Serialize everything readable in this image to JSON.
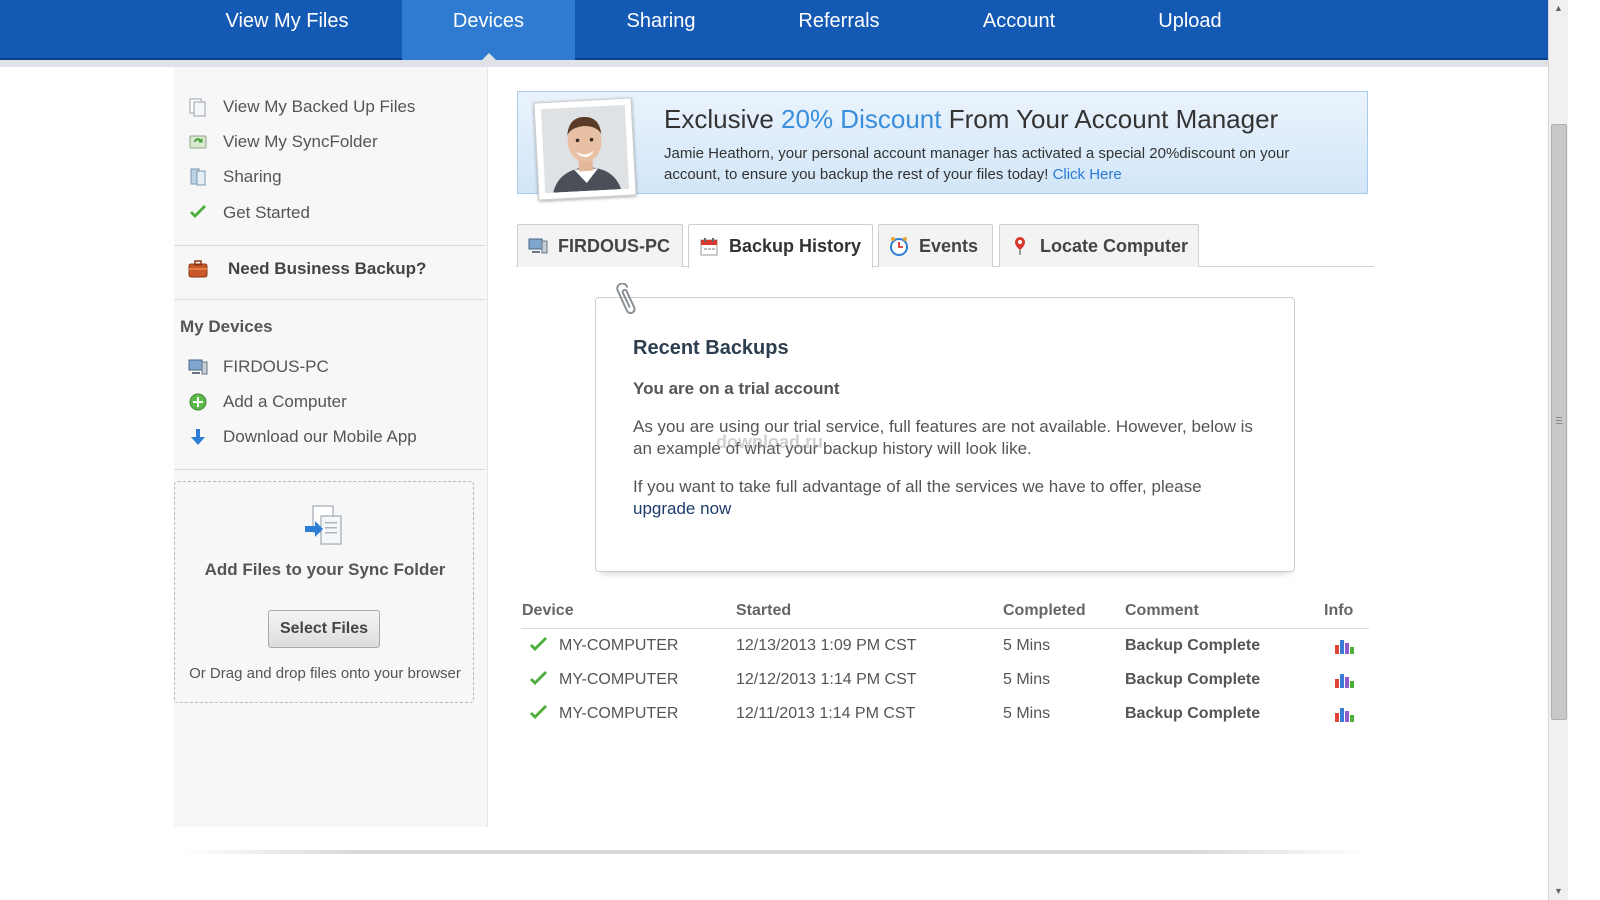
{
  "nav": {
    "items": [
      {
        "label": "View My Files"
      },
      {
        "label": "Devices"
      },
      {
        "label": "Sharing"
      },
      {
        "label": "Referrals"
      },
      {
        "label": "Account"
      },
      {
        "label": "Upload"
      }
    ],
    "active": "Devices"
  },
  "sidebar": {
    "links": [
      {
        "label": "View My Backed Up Files",
        "icon": "files-icon"
      },
      {
        "label": "View My SyncFolder",
        "icon": "sync-icon"
      },
      {
        "label": "Sharing",
        "icon": "share-icon"
      },
      {
        "label": "Get Started",
        "icon": "checkmark-icon"
      }
    ],
    "business": "Need Business Backup?",
    "my_devices_heading": "My Devices",
    "devices": [
      {
        "label": "FIRDOUS-PC",
        "icon": "computer-icon"
      },
      {
        "label": "Add a Computer",
        "icon": "plus-circle-icon"
      },
      {
        "label": "Download our Mobile App",
        "icon": "download-arrow-icon"
      }
    ],
    "dropzone": {
      "title": "Add Files to your Sync Folder",
      "button": "Select Files",
      "hint": "Or Drag and drop files onto your browser"
    }
  },
  "banner": {
    "title_pre": "Exclusive ",
    "title_highlight": "20% Discount",
    "title_post": " From Your Account Manager",
    "text": "Jamie Heathorn, your personal account manager has activated a special 20%discount on your account, to ensure you backup the rest of your files today!",
    "link": "Click Here"
  },
  "tabs": [
    {
      "label": "FIRDOUS-PC",
      "icon": "computer-icon"
    },
    {
      "label": "Backup History",
      "icon": "calendar-icon"
    },
    {
      "label": "Events",
      "icon": "clock-icon"
    },
    {
      "label": "Locate Computer",
      "icon": "map-pin-icon"
    }
  ],
  "active_tab": "Backup History",
  "recent": {
    "heading": "Recent Backups",
    "subheading": "You are on a trial account",
    "para1": "As you are using our trial service, full features are not available. However, below is an example of what your backup history will look like.",
    "para2": "If you want to take full advantage of all the services we have to offer, please",
    "link": "upgrade now"
  },
  "watermark": "download.ru",
  "table": {
    "headers": [
      "Device",
      "Started",
      "Completed",
      "Comment",
      "Info"
    ],
    "rows": [
      {
        "device": "MY-COMPUTER",
        "started": "12/13/2013 1:09 PM CST",
        "completed": "5 Mins",
        "comment": "Backup Complete"
      },
      {
        "device": "MY-COMPUTER",
        "started": "12/12/2013 1:14 PM CST",
        "completed": "5 Mins",
        "comment": "Backup Complete"
      },
      {
        "device": "MY-COMPUTER",
        "started": "12/11/2013 1:14 PM CST",
        "completed": "5 Mins",
        "comment": "Backup Complete"
      }
    ]
  },
  "colors": {
    "nav_bg": "#1459b3",
    "nav_active": "#2e7bd1",
    "link": "#2a7ad2",
    "highlight": "#3a8edb",
    "check": "#4caf3c"
  }
}
